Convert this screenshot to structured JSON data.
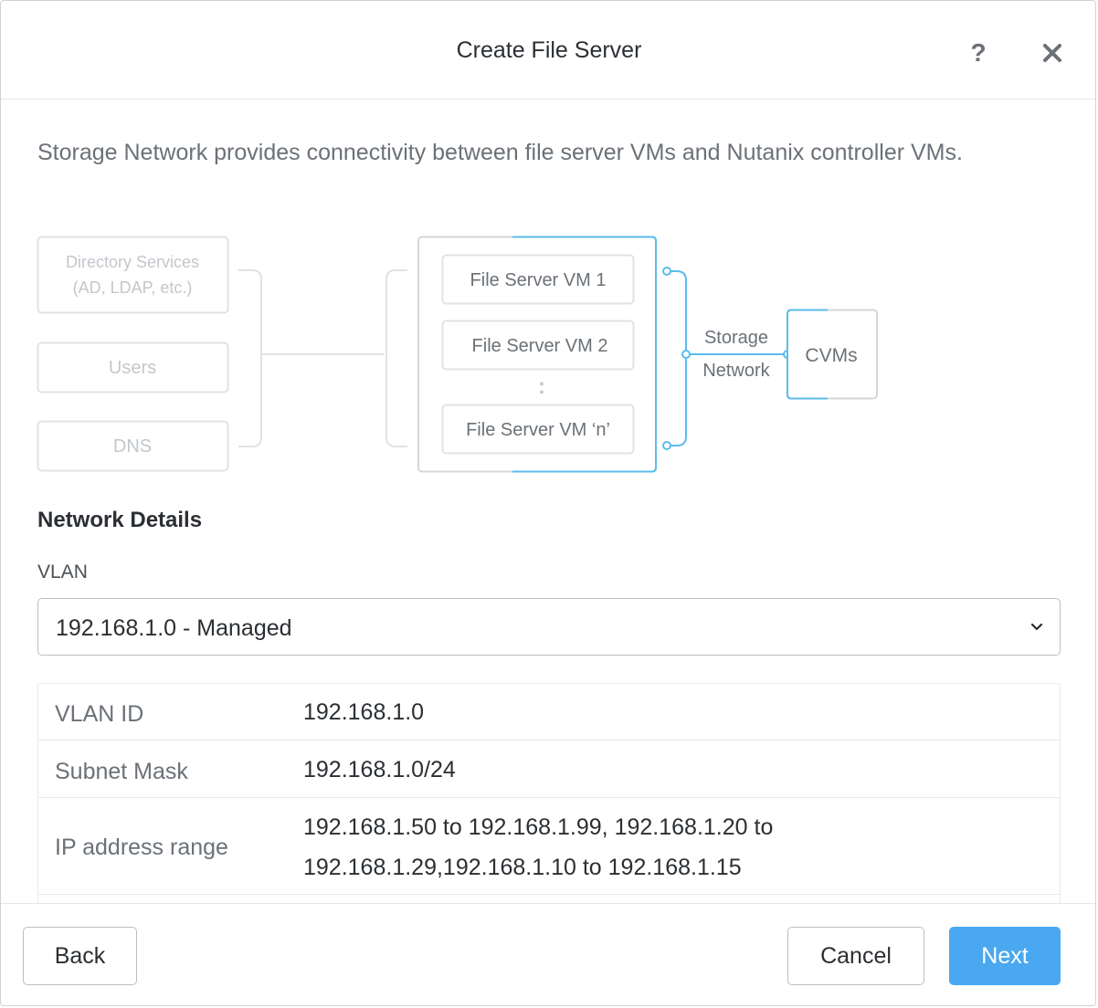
{
  "dialog": {
    "title": "Create File Server",
    "help_glyph": "?",
    "description": "Storage Network provides connectivity between file server VMs and Nutanix controller VMs."
  },
  "diagram": {
    "services": [
      {
        "line1": "Directory Services",
        "line2": "(AD, LDAP, etc.)"
      },
      {
        "line1": "Users"
      },
      {
        "line1": "DNS"
      }
    ],
    "vms": [
      "File Server VM 1",
      "File Server VM 2",
      "File Server VM ‘n’"
    ],
    "ellipsis": ":",
    "network_label_line1": "Storage",
    "network_label_line2": "Network",
    "cvms": "CVMs",
    "colors": {
      "accent": "#5bbcec",
      "muted_border": "#dfe3e6",
      "muted_text": "#c3c7cb"
    }
  },
  "network_details": {
    "section_title": "Network Details",
    "vlan_label": "VLAN",
    "vlan_selected": "192.168.1.0 - Managed",
    "rows": [
      {
        "key": "VLAN ID",
        "value": "192.168.1.0"
      },
      {
        "key": "Subnet Mask",
        "value": "192.168.1.0/24"
      },
      {
        "key": "IP address range",
        "value_line1": "192.168.1.50 to 192.168.1.99, 192.168.1.20 to",
        "value_line2": "192.168.1.29,192.168.1.10 to 192.168.1.15"
      }
    ]
  },
  "footer": {
    "back_label": "Back",
    "cancel_label": "Cancel",
    "next_label": "Next",
    "primary_color": "#4aa8f0"
  }
}
